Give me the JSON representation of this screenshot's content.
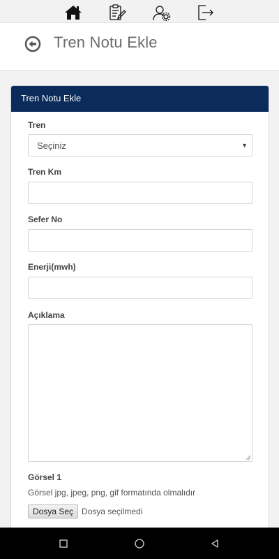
{
  "topnav": {
    "icons": [
      "home-icon",
      "clipboard-edit-icon",
      "user-settings-icon",
      "logout-icon"
    ]
  },
  "header": {
    "title": "Tren Notu Ekle"
  },
  "card": {
    "title": "Tren Notu Ekle"
  },
  "form": {
    "train_label": "Tren",
    "train_select_value": "Seçiniz",
    "train_km_label": "Tren Km",
    "train_km_value": "",
    "trip_no_label": "Sefer No",
    "trip_no_value": "",
    "energy_label": "Enerji(mwh)",
    "energy_value": "",
    "description_label": "Açıklama",
    "description_value": "",
    "image1_label": "Görsel 1",
    "image1_hint": "Görsel jpg, jpeg, png, gif formatında olmalıdır",
    "file_button_label": "Dosya Seç",
    "file_status": "Dosya seçilmedi"
  },
  "android_nav": {
    "icons": [
      "recents-square-icon",
      "home-circle-icon",
      "back-triangle-icon"
    ]
  },
  "colors": {
    "card_header_bg": "#0b2c5a",
    "page_bg": "#f2f2f2"
  }
}
